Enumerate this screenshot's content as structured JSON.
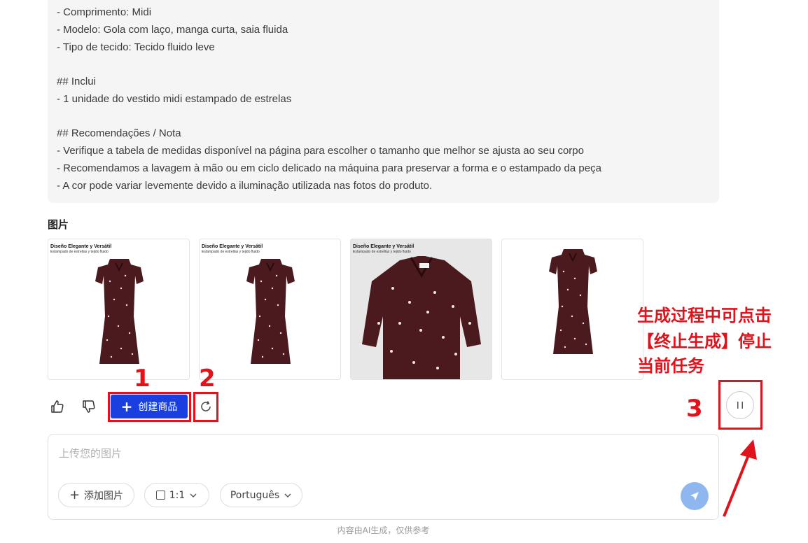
{
  "description": {
    "lines": [
      "- Comprimento: Midi",
      "- Modelo: Gola com laço, manga curta, saia fluida",
      "- Tipo de tecido: Tecido fluido leve",
      "## Inclui",
      "- 1 unidade do vestido midi estampado de estrelas",
      "## Recomendações / Nota",
      "- Verifique a tabela de medidas disponível na página para escolher o tamanho que melhor se ajusta ao seu corpo",
      "- Recomendamos a lavagem à mão ou em ciclo delicado na máquina para preservar a forma e o estampado da peça",
      "- A cor pode variar levemente devido a iluminação utilizada nas fotos do produto."
    ]
  },
  "images_section": {
    "title": "图片",
    "thumbnails": [
      {
        "caption": "Diseño Elegante y Versátil",
        "subcaption": "Estampado de estrellas y tejido fluido",
        "kind": "dress"
      },
      {
        "caption": "Diseño Elegante y Versátil",
        "subcaption": "Estampado de estrellas y tejido fluido",
        "kind": "dress"
      },
      {
        "caption": "Diseño Elegante y Versátil",
        "subcaption": "Estampado de estrellas y tejido fluido",
        "kind": "closeup"
      },
      {
        "caption": "",
        "subcaption": "",
        "kind": "dress"
      }
    ]
  },
  "actions": {
    "like_icon": "thumbs-up-icon",
    "dislike_icon": "thumbs-down-icon",
    "create_label": "创建商品",
    "refresh_icon": "refresh-icon",
    "pause_icon": "pause-icon"
  },
  "annotations": {
    "num1": "1",
    "num2": "2",
    "num3": "3",
    "note_lines": [
      "生成过程中可点击",
      "【终止生成】停止",
      "当前任务"
    ],
    "color": "#e0121b"
  },
  "input": {
    "placeholder": "上传您的图片",
    "add_image_label": "添加图片",
    "ratio_label": "1:1",
    "language_label": "Português",
    "send_icon": "send-icon"
  },
  "footer": {
    "note": "内容由AI生成，仅供参考"
  },
  "colors": {
    "primary": "#1a3fe0",
    "send": "#8fb7ef",
    "dress": "#4a1a1f"
  }
}
